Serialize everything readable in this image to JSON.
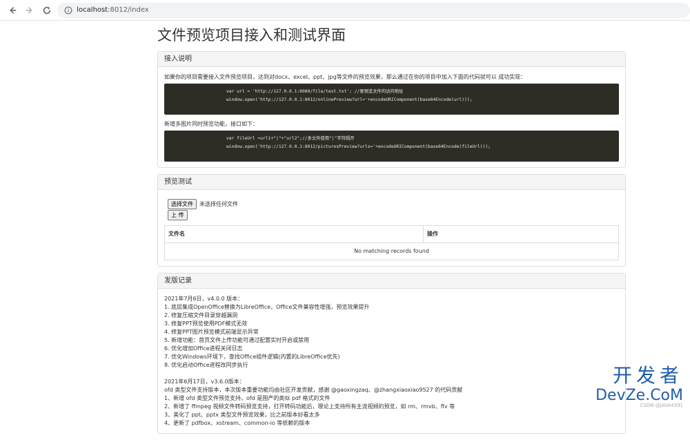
{
  "browser": {
    "url_host": "localhost",
    "url_path": ":8012/index"
  },
  "page": {
    "title": "文件预览项目接入和测试界面"
  },
  "access_panel": {
    "heading": "接入说明",
    "desc1": "如果你的项目需要接入文件预览项目，达到对docx、excel、ppt、jpg等文件的预览效果，那么通过在你的项目中加入下面的代码就可以 成功实现：",
    "code1_line1": "var url = 'http://127.0.0.1:8080/file/test.txt'; //要预览文件的访问地址",
    "code1_line2": "window.open('http://127.0.0.1:8012/onlinePreview?url='+encodeURIComponent(base64Encode(url)));",
    "desc2": "新增多图片同时预览功能，接口如下：",
    "code2_line1": "var fileUrl =url1+\"|\"+\"url2\";//多文件使用\"|\"字符隔开",
    "code2_line2": "window.open('http://127.0.0.1:8012/picturesPreview?urls='+encodeURIComponent(base64Encode(fileUrl)));"
  },
  "test_panel": {
    "heading": "预览测试",
    "choose_file_label": "选择文件",
    "no_file_text": "未选择任何文件",
    "upload_label": "上 传",
    "table": {
      "col_filename": "文件名",
      "col_action": "操作",
      "empty_text": "No matching records found"
    }
  },
  "release_panel": {
    "heading": "发版记录",
    "v400": [
      "2021年7月6日，v4.0.0 版本：",
      "1. 底层集成OpenOffice替换为LibreOffice，Office文件兼容性增强，预览效果提升",
      "2. 修复压缩文件目录穿越漏洞",
      "3. 修复PPT预览使用PDF模式无效",
      "4. 修复PPT图片预览模式前端显示异常",
      "5. 新增功能：首页文件上传功能可通过配置实时开启或禁用",
      "6. 优化增加Office进程关闭日志",
      "7. 优化Windows环境下，查找Office组件逻辑(内置的LibreOffice优先)",
      "8. 优化启动Office进程改同步执行"
    ],
    "v360": [
      "2021年6月17日，v3.6.0版本：",
      "ofd 类型文件支持版本，本次版本重要功能均由社区开发贡献，感谢 @gaoxingzaq、@zhangxiaoxiao9527 的代码贡献",
      "1、新增 ofd 类型文件预览支持，ofd 是国产的类似 pdf 格式的文件",
      "2、新增了 ffmpeg 视频文件转码预览支持，打开转码功能后，理论上支持所有主流视频的预览，如 rm、rmvb、flv 等",
      "3、美化了 ppt、pptx 类型文件预览效果，比之前版本好看太多",
      "4、更新了 pdfbox、xstream、common-io 等依赖的版本"
    ]
  },
  "watermark": {
    "line1": "开发者",
    "line2": "DevZe.CoM",
    "csdn": "CSDN @JAVA4391"
  }
}
